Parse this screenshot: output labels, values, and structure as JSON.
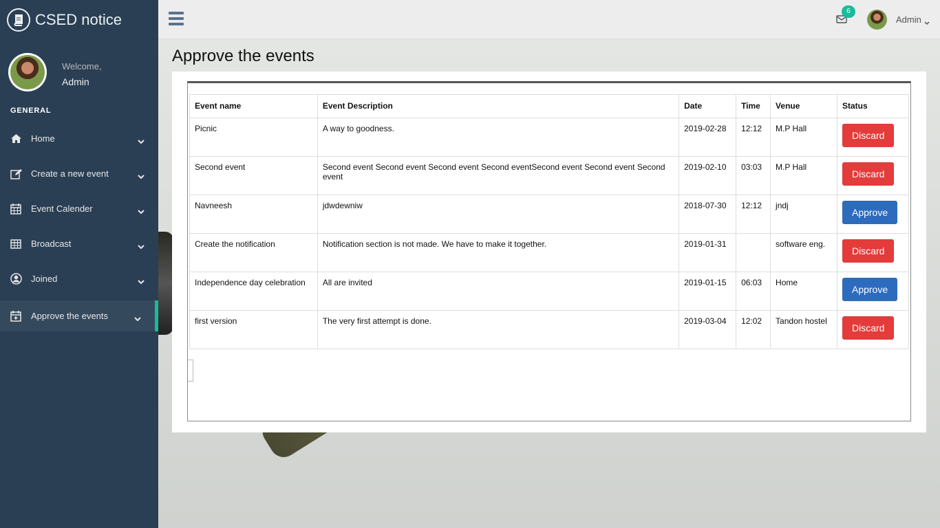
{
  "app": {
    "brand": "CSED notice"
  },
  "profile": {
    "welcome": "Welcome,",
    "name": "Admin"
  },
  "sidebar": {
    "section": "GENERAL",
    "items": [
      {
        "label": "Home",
        "icon": "home-icon"
      },
      {
        "label": "Create a new event",
        "icon": "edit-icon"
      },
      {
        "label": "Event Calender",
        "icon": "calendar-icon"
      },
      {
        "label": "Broadcast",
        "icon": "table-icon"
      },
      {
        "label": "Joined",
        "icon": "user-circle-icon"
      },
      {
        "label": "Approve the events",
        "icon": "calendar-plus-icon",
        "active": true
      }
    ]
  },
  "topnav": {
    "mail_count": "6",
    "user": "Admin"
  },
  "main": {
    "title": "Approve the events",
    "columns": [
      "Event name",
      "Event Description",
      "Date",
      "Time",
      "Venue",
      "Status"
    ],
    "rows": [
      {
        "name": "Picnic",
        "description": "A way to goodness.",
        "date": "2019-02-28",
        "time": "12:12",
        "venue": "M.P Hall",
        "status": "Discard"
      },
      {
        "name": "Second event",
        "description": "Second event Second event Second event Second eventSecond event Second event Second event",
        "date": "2019-02-10",
        "time": "03:03",
        "venue": "M.P Hall",
        "status": "Discard"
      },
      {
        "name": "Navneesh",
        "description": "jdwdewniw",
        "date": "2018-07-30",
        "time": "12:12",
        "venue": "jndj",
        "status": "Approve"
      },
      {
        "name": "Create the notification",
        "description": "Notification section is not made. We have to make it together.",
        "date": "2019-01-31",
        "time": "",
        "venue": "software eng.",
        "status": "Discard"
      },
      {
        "name": "Independence day celebration",
        "description": "All are invited",
        "date": "2019-01-15",
        "time": "06:03",
        "venue": "Home",
        "status": "Approve"
      },
      {
        "name": "first version",
        "description": "The very first attempt is done.",
        "date": "2019-03-04",
        "time": "12:02",
        "venue": "Tandon hostel",
        "status": "Discard"
      }
    ]
  },
  "colors": {
    "sidebar": "#2a3f54",
    "accent": "#1abb9c",
    "danger": "#e43b3b",
    "primary": "#2c6bbd"
  }
}
